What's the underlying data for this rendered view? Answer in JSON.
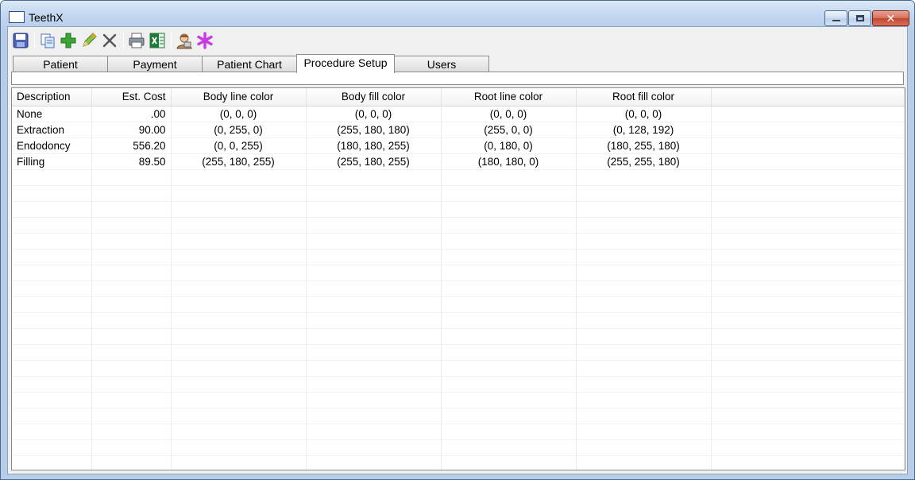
{
  "window": {
    "title": "TeethX"
  },
  "toolbar": {
    "icons": [
      "save-icon",
      "copy-icon",
      "add-icon",
      "edit-icon",
      "delete-icon",
      "print-icon",
      "excel-export-icon",
      "user-icon",
      "asterisk-icon"
    ],
    "colors": {
      "add": "#3aa535",
      "edit": "#e7a322",
      "asterisk": "#c93be0",
      "excel": "#1f7a3a"
    }
  },
  "tabs": [
    {
      "label": "Patient"
    },
    {
      "label": "Payment"
    },
    {
      "label": "Patient Chart"
    },
    {
      "label": "Procedure Setup",
      "active": true
    },
    {
      "label": "Users"
    }
  ],
  "table": {
    "columns": [
      "Description",
      "Est. Cost",
      "Body line color",
      "Body fill color",
      "Root line color",
      "Root fill color"
    ],
    "rows": [
      [
        "None",
        ".00",
        "(0, 0, 0)",
        "(0, 0, 0)",
        "(0, 0, 0)",
        "(0, 0, 0)"
      ],
      [
        "Extraction",
        "90.00",
        "(0, 255, 0)",
        "(255, 180, 180)",
        "(255, 0, 0)",
        "(0, 128, 192)"
      ],
      [
        "Endodoncy",
        "556.20",
        "(0, 0, 255)",
        "(180, 180, 255)",
        "(0, 180, 0)",
        "(180, 255, 180)"
      ],
      [
        "Filling",
        "89.50",
        "(255, 180, 255)",
        "(255, 180, 255)",
        "(180, 180, 0)",
        "(255, 255, 180)"
      ]
    ]
  }
}
